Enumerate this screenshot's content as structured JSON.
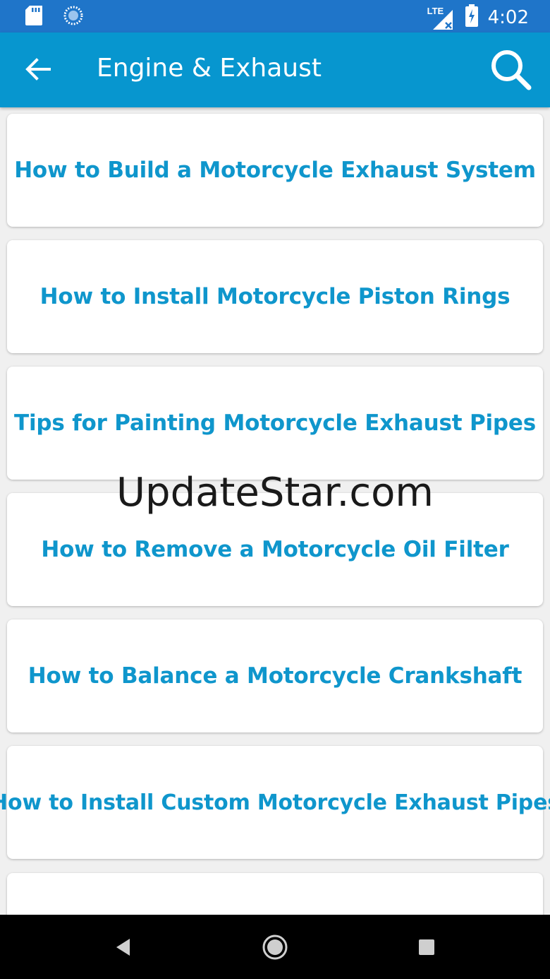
{
  "status_bar": {
    "network": "LTE",
    "time": "4:02",
    "icons": [
      "sd-card-icon",
      "sync-icon",
      "lte-signal-icon",
      "battery-charging-icon"
    ]
  },
  "app_bar": {
    "title": "Engine & Exhaust",
    "back_icon": "back-arrow-icon",
    "search_icon": "search-icon",
    "color": "#0796cf"
  },
  "list": {
    "items": [
      {
        "label": "How to Build a Motorcycle Exhaust System"
      },
      {
        "label": "How to Install Motorcycle Piston Rings"
      },
      {
        "label": "Tips for Painting Motorcycle Exhaust Pipes"
      },
      {
        "label": "How to Remove a Motorcycle Oil Filter"
      },
      {
        "label": "How to Balance a Motorcycle Crankshaft"
      },
      {
        "label": "How to Install Custom Motorcycle Exhaust Pipes"
      },
      {
        "label": ""
      }
    ],
    "label_color": "#0f96cc"
  },
  "watermark": "UpdateStar.com",
  "nav_bar": {
    "icons": [
      "back-triangle-icon",
      "home-circle-icon",
      "recents-square-icon"
    ]
  }
}
